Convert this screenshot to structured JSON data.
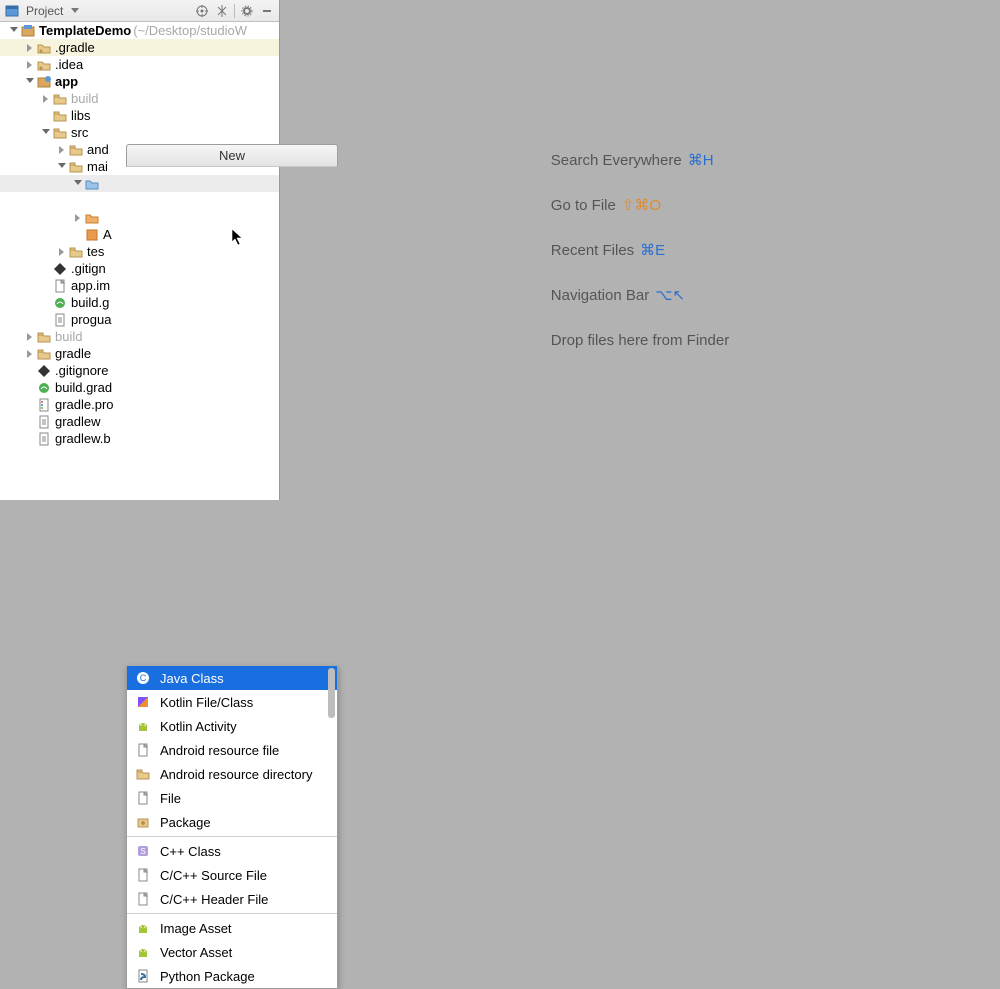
{
  "header": {
    "title": "Project"
  },
  "tree": [
    {
      "indent": 8,
      "arrow": "down",
      "icon": "project",
      "label": "TemplateDemo",
      "path": "(~/Desktop/studioW",
      "bold": true,
      "highlight": false
    },
    {
      "indent": 24,
      "arrow": "right",
      "icon": "folder-dot",
      "label": ".gradle",
      "highlight": true
    },
    {
      "indent": 24,
      "arrow": "right",
      "icon": "folder-dot",
      "label": ".idea"
    },
    {
      "indent": 24,
      "arrow": "down",
      "icon": "module",
      "label": "app",
      "bold": true
    },
    {
      "indent": 40,
      "arrow": "right",
      "icon": "folder",
      "label": "build",
      "dim": true
    },
    {
      "indent": 40,
      "arrow": "none",
      "icon": "folder",
      "label": "libs"
    },
    {
      "indent": 40,
      "arrow": "down",
      "icon": "folder",
      "label": "src"
    },
    {
      "indent": 56,
      "arrow": "right",
      "icon": "folder",
      "label": "and"
    },
    {
      "indent": 56,
      "arrow": "down",
      "icon": "folder",
      "label": "mai"
    },
    {
      "indent": 72,
      "arrow": "down",
      "icon": "folder-blue",
      "label": "",
      "selected": true
    },
    {
      "indent": 72,
      "arrow": "none",
      "icon": "spacer",
      "label": ""
    },
    {
      "indent": 72,
      "arrow": "right",
      "icon": "folder-orange",
      "label": ""
    },
    {
      "indent": 72,
      "arrow": "none",
      "icon": "xml",
      "label": "A"
    },
    {
      "indent": 56,
      "arrow": "right",
      "icon": "folder",
      "label": "tes"
    },
    {
      "indent": 40,
      "arrow": "none",
      "icon": "gitignore",
      "label": ".gitign"
    },
    {
      "indent": 40,
      "arrow": "none",
      "icon": "file",
      "label": "app.im"
    },
    {
      "indent": 40,
      "arrow": "none",
      "icon": "gradle",
      "label": "build.g"
    },
    {
      "indent": 40,
      "arrow": "none",
      "icon": "text",
      "label": "progua"
    },
    {
      "indent": 24,
      "arrow": "right",
      "icon": "folder",
      "label": "build",
      "dim": true
    },
    {
      "indent": 24,
      "arrow": "right",
      "icon": "folder",
      "label": "gradle"
    },
    {
      "indent": 24,
      "arrow": "none",
      "icon": "gitignore",
      "label": ".gitignore"
    },
    {
      "indent": 24,
      "arrow": "none",
      "icon": "gradle",
      "label": "build.grad"
    },
    {
      "indent": 24,
      "arrow": "none",
      "icon": "props",
      "label": "gradle.pro"
    },
    {
      "indent": 24,
      "arrow": "none",
      "icon": "text",
      "label": "gradlew"
    },
    {
      "indent": 24,
      "arrow": "none",
      "icon": "text",
      "label": "gradlew.b"
    }
  ],
  "welcome": {
    "search": {
      "text": "Search Everywhere",
      "shortcut": "⌘H",
      "color": ""
    },
    "gotofile": {
      "text": "Go to File",
      "shortcut": "⇧⌘O",
      "color": "orange"
    },
    "recent": {
      "text": "Recent Files",
      "shortcut": "⌘E",
      "color": ""
    },
    "navbar": {
      "text": "Navigation Bar",
      "shortcut": "⌥↖",
      "color": ""
    },
    "drop": {
      "text": "Drop files here from Finder"
    }
  },
  "menu": {
    "title": "New",
    "items": [
      {
        "icon": "class-c",
        "label": "Java Class",
        "selected": true
      },
      {
        "icon": "kotlin",
        "label": "Kotlin File/Class"
      },
      {
        "icon": "android",
        "label": "Kotlin Activity"
      },
      {
        "icon": "file",
        "label": "Android resource file"
      },
      {
        "icon": "folder",
        "label": "Android resource directory"
      },
      {
        "icon": "file",
        "label": "File"
      },
      {
        "icon": "package",
        "label": "Package"
      },
      {
        "sep": true
      },
      {
        "icon": "cpp-s",
        "label": "C++ Class"
      },
      {
        "icon": "file",
        "label": "C/C++ Source File"
      },
      {
        "icon": "file",
        "label": "C/C++ Header File"
      },
      {
        "sep": true
      },
      {
        "icon": "android",
        "label": "Image Asset"
      },
      {
        "icon": "android",
        "label": "Vector Asset"
      },
      {
        "icon": "python",
        "label": "Python Package"
      }
    ]
  }
}
